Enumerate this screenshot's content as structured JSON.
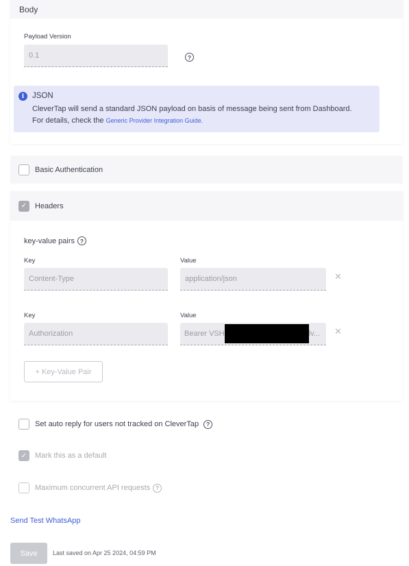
{
  "body_section": {
    "title": "Body",
    "payload_version_label": "Payload Version",
    "payload_version_value": "0.1",
    "help_icon": "question-circle-icon",
    "info": {
      "icon": "info-icon",
      "title": "JSON",
      "text": "CleverTap will send a standard JSON payload on basis of message being sent from Dashboard.",
      "details_prefix": "For details, check the ",
      "link_label": "Generic Provider Integration Guide."
    }
  },
  "basic_auth": {
    "label": "Basic Authentication",
    "checked": false
  },
  "headers": {
    "label": "Headers",
    "checked": true,
    "kv_label": "key-value pairs",
    "pairs": [
      {
        "key_label": "Key",
        "key": "Content-Type",
        "value_label": "Value",
        "value": "application/json"
      },
      {
        "key_label": "Key",
        "key": "Authorization",
        "value_label": "Value",
        "value_prefix": "Bearer VSH",
        "value_suffix": "lv..."
      }
    ],
    "add_button": "+ Key-Value Pair"
  },
  "options": {
    "auto_reply": {
      "label": "Set auto reply for users not tracked on CleverTap",
      "checked": false
    },
    "mark_default": {
      "label": "Mark this as a default",
      "checked": true,
      "disabled": true
    },
    "max_concurrent": {
      "label": "Maximum concurrent API requests",
      "checked": false,
      "disabled": true
    }
  },
  "send_test_link": "Send Test WhatsApp",
  "footer": {
    "save_label": "Save",
    "last_saved": "Last saved on Apr 25 2024, 04:59 PM"
  },
  "colors": {
    "accent": "#3e5ed9",
    "info_bg": "#e6e8fa",
    "section_bg": "#f6f6f8"
  }
}
